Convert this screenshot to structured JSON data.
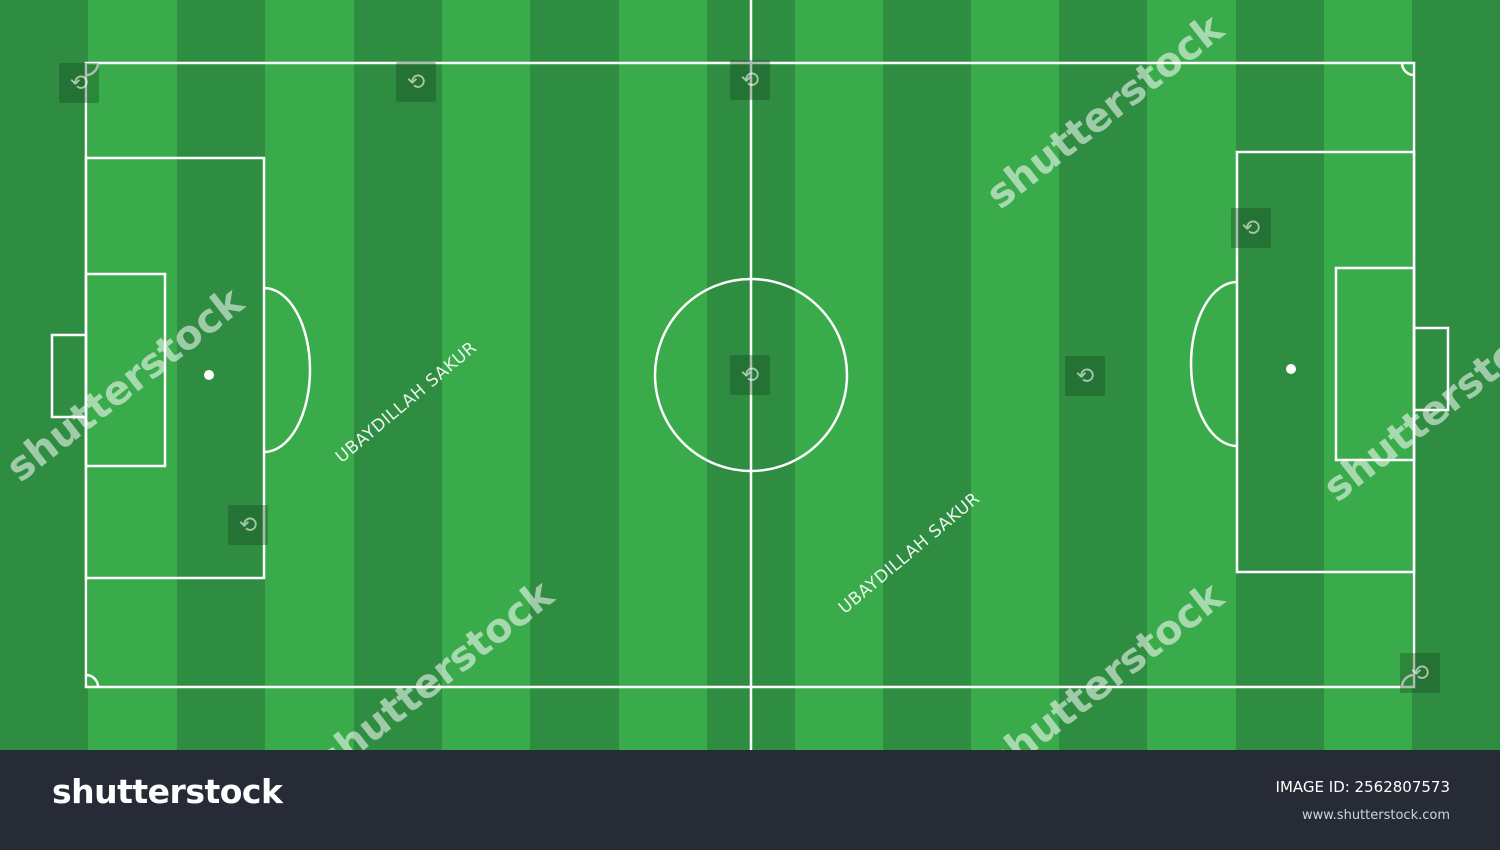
{
  "colors": {
    "stripe_light": "#3aab4a",
    "stripe_dark": "#2e8d41",
    "line": "#ffffff",
    "footer_bg": "#262b35"
  },
  "watermarks": {
    "author_1": "UBAYDILLAH SAKUR",
    "author_2": "UBAYDILLAH SAKUR",
    "brand_1": "shutterstock",
    "brand_2": "shutterstock",
    "brand_3": "shutterstock",
    "brand_4": "shutterstock",
    "brand_5": "shutterstock",
    "icon": "shutterstock-logo-icon"
  },
  "footer": {
    "logo": "shutterstock",
    "image_id": "IMAGE ID: 2562807573",
    "url": "www.shutterstock.com"
  }
}
